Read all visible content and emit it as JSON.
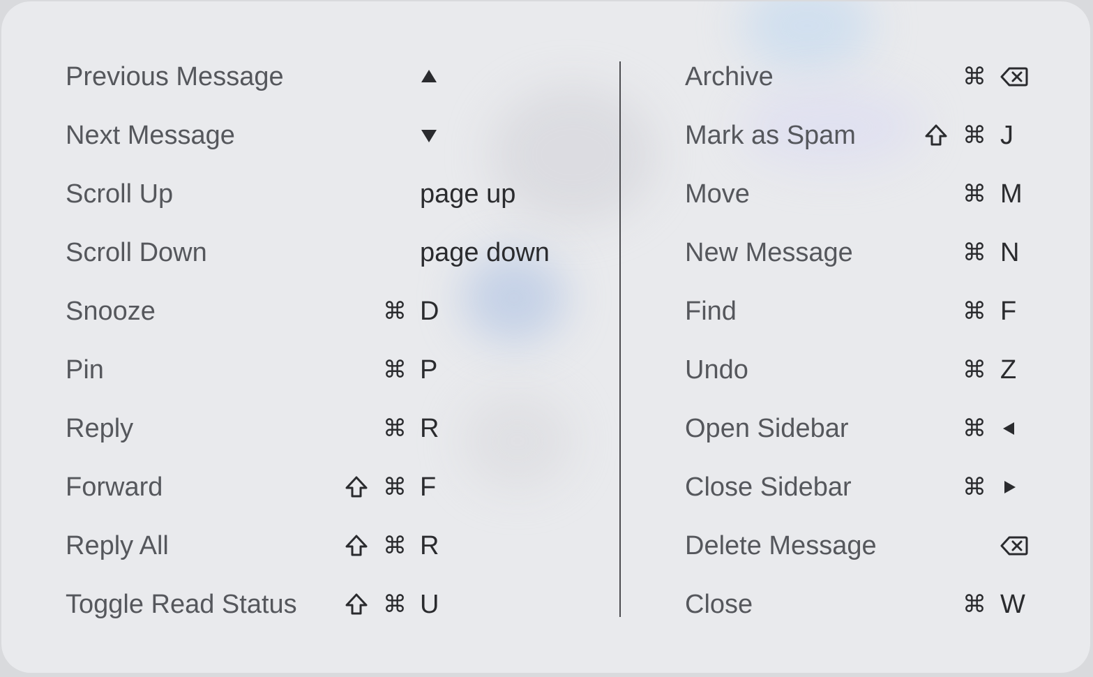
{
  "left_column": [
    {
      "label": "Previous Message",
      "keys": [
        {
          "type": "icon",
          "icon": "up-arrow-icon"
        }
      ]
    },
    {
      "label": "Next Message",
      "keys": [
        {
          "type": "icon",
          "icon": "down-arrow-icon"
        }
      ]
    },
    {
      "label": "Scroll Up",
      "keys": [
        {
          "type": "text",
          "text": "page up"
        }
      ]
    },
    {
      "label": "Scroll Down",
      "keys": [
        {
          "type": "text",
          "text": "page down"
        }
      ]
    },
    {
      "label": "Snooze",
      "keys": [
        {
          "type": "text",
          "text": "⌘"
        },
        {
          "type": "text",
          "text": "D"
        }
      ]
    },
    {
      "label": "Pin",
      "keys": [
        {
          "type": "text",
          "text": "⌘"
        },
        {
          "type": "text",
          "text": "P"
        }
      ]
    },
    {
      "label": "Reply",
      "keys": [
        {
          "type": "text",
          "text": "⌘"
        },
        {
          "type": "text",
          "text": "R"
        }
      ]
    },
    {
      "label": "Forward",
      "keys": [
        {
          "type": "icon",
          "icon": "shift-icon"
        },
        {
          "type": "text",
          "text": "⌘"
        },
        {
          "type": "text",
          "text": "F"
        }
      ]
    },
    {
      "label": "Reply All",
      "keys": [
        {
          "type": "icon",
          "icon": "shift-icon"
        },
        {
          "type": "text",
          "text": "⌘"
        },
        {
          "type": "text",
          "text": "R"
        }
      ]
    },
    {
      "label": "Toggle Read Status",
      "keys": [
        {
          "type": "icon",
          "icon": "shift-icon"
        },
        {
          "type": "text",
          "text": "⌘"
        },
        {
          "type": "text",
          "text": "U"
        }
      ]
    }
  ],
  "right_column": [
    {
      "label": "Archive",
      "keys": [
        {
          "type": "text",
          "text": "⌘"
        },
        {
          "type": "icon",
          "icon": "delete-key-icon"
        }
      ]
    },
    {
      "label": "Mark as Spam",
      "keys": [
        {
          "type": "icon",
          "icon": "shift-icon"
        },
        {
          "type": "text",
          "text": "⌘"
        },
        {
          "type": "text",
          "text": "J"
        }
      ]
    },
    {
      "label": "Move",
      "keys": [
        {
          "type": "text",
          "text": "⌘"
        },
        {
          "type": "text",
          "text": "M"
        }
      ]
    },
    {
      "label": "New Message",
      "keys": [
        {
          "type": "text",
          "text": "⌘"
        },
        {
          "type": "text",
          "text": "N"
        }
      ]
    },
    {
      "label": "Find",
      "keys": [
        {
          "type": "text",
          "text": "⌘"
        },
        {
          "type": "text",
          "text": "F"
        }
      ]
    },
    {
      "label": "Undo",
      "keys": [
        {
          "type": "text",
          "text": "⌘"
        },
        {
          "type": "text",
          "text": "Z"
        }
      ]
    },
    {
      "label": "Open Sidebar",
      "keys": [
        {
          "type": "text",
          "text": "⌘"
        },
        {
          "type": "icon",
          "icon": "left-arrow-icon"
        }
      ]
    },
    {
      "label": "Close Sidebar",
      "keys": [
        {
          "type": "text",
          "text": "⌘"
        },
        {
          "type": "icon",
          "icon": "right-arrow-icon"
        }
      ]
    },
    {
      "label": "Delete Message",
      "keys": [
        {
          "type": "icon",
          "icon": "delete-key-icon"
        }
      ]
    },
    {
      "label": "Close",
      "keys": [
        {
          "type": "text",
          "text": "⌘"
        },
        {
          "type": "text",
          "text": "W"
        }
      ]
    }
  ]
}
